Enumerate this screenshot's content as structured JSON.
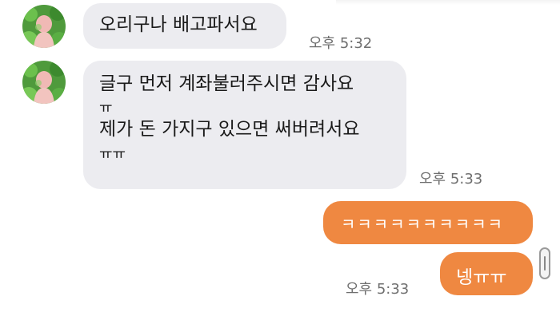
{
  "messages": {
    "m1": {
      "text": "오리구나 배고파서요",
      "time": "오후 5:32"
    },
    "m2": {
      "lines": [
        "글구 먼저 계좌불러주시면 감사요",
        "ㅠ",
        "제가 돈 가지구 있으면 써버려서요",
        "ㅠㅠ"
      ],
      "time": "오후 5:33"
    },
    "m3": {
      "text": "ㅋㅋㅋㅋㅋㅋㅋㅋㅋㅋ"
    },
    "m4": {
      "text": "넹ㅠㅠ",
      "time": "오후 5:33"
    }
  },
  "colors": {
    "incoming_bubble": "#ececf0",
    "outgoing_bubble": "#ef8841",
    "timestamp": "#6f6f6f"
  }
}
